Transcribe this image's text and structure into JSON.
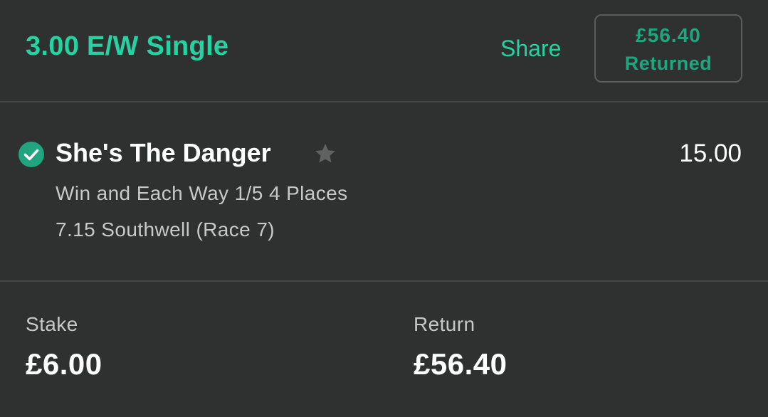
{
  "header": {
    "bet_title": "3.00 E/W Single",
    "share_label": "Share",
    "returned_amount": "£56.40",
    "returned_label": "Returned"
  },
  "selection": {
    "status_icon": "check-circle-icon",
    "runner_name": "She's The Danger",
    "favourite_icon": "star-icon",
    "odds": "15.00",
    "market": "Win and Each Way 1/5 4 Places",
    "event": "7.15 Southwell (Race 7)"
  },
  "totals": {
    "stake_label": "Stake",
    "stake_value": "£6.00",
    "return_label": "Return",
    "return_value": "£56.40"
  },
  "colors": {
    "accent": "#25d3a2",
    "background": "#2f3130",
    "divider": "#444746",
    "check_green": "#1fa67f",
    "star_grey": "#5f6261"
  }
}
